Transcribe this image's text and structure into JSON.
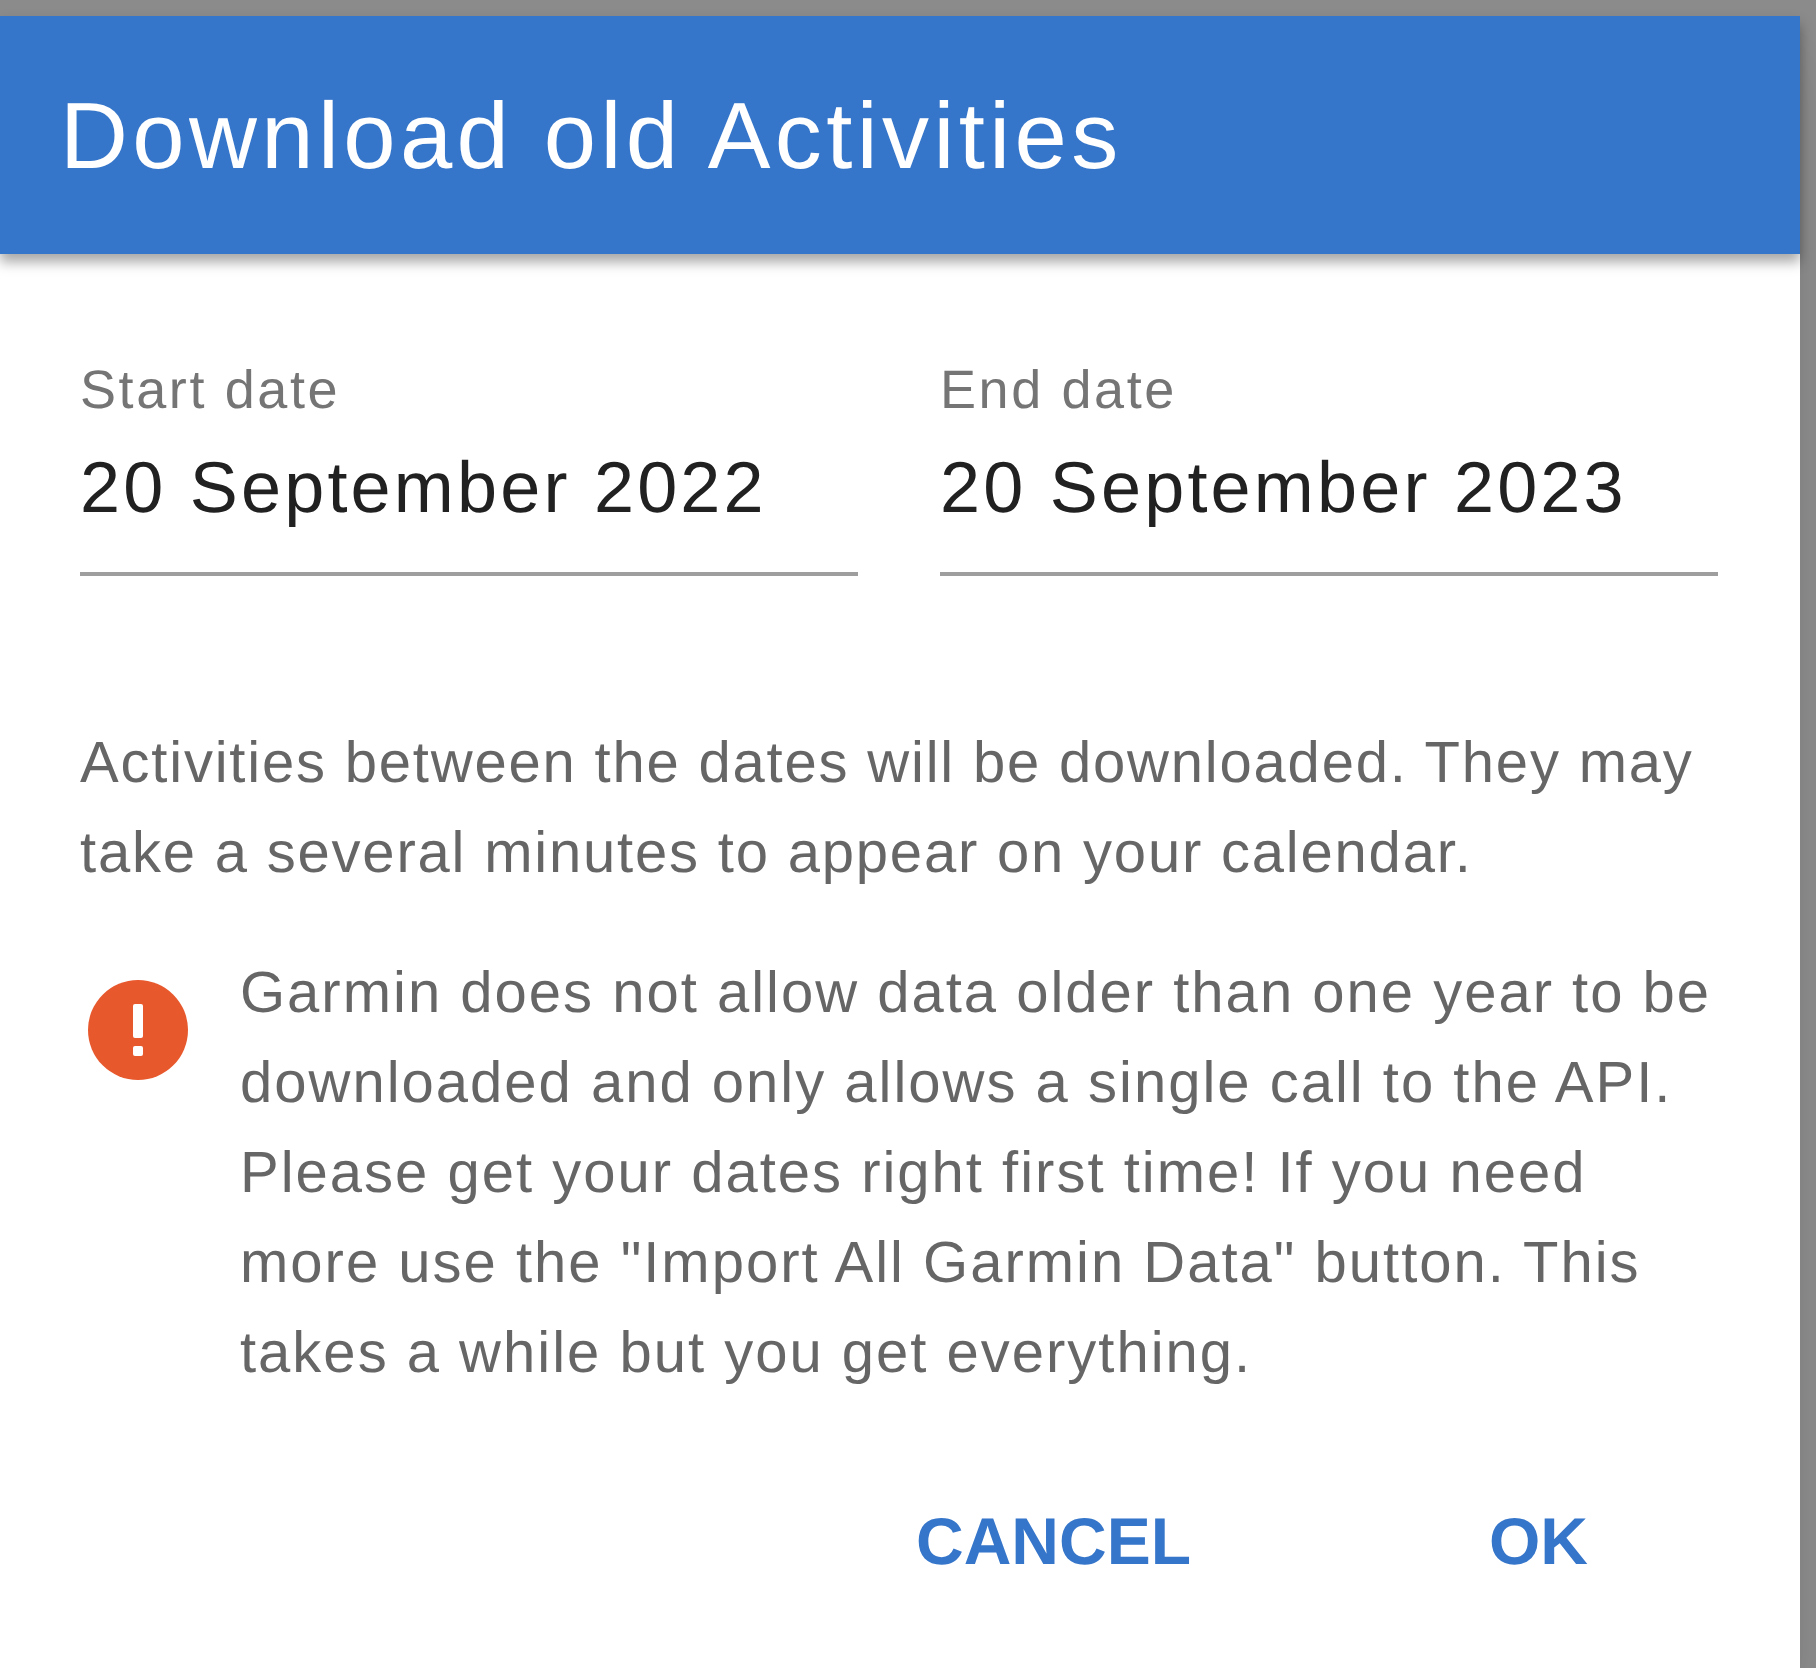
{
  "dialog": {
    "title": "Download old Activities",
    "fields": [
      {
        "label": "Start date",
        "value": "20 September 2022"
      },
      {
        "label": "End date",
        "value": "20 September 2023"
      }
    ],
    "info": "Activities between the dates will be downloaded. They may take a several minutes to appear on your calendar.",
    "warning": "Garmin does not allow data older than one year to be downloaded and only allows a single call to the API. Please get your dates right first time! If you need more use the \"Import All Garmin Data\" button. This takes a while but you get everything.",
    "buttons": [
      "CANCEL",
      "OK"
    ]
  }
}
